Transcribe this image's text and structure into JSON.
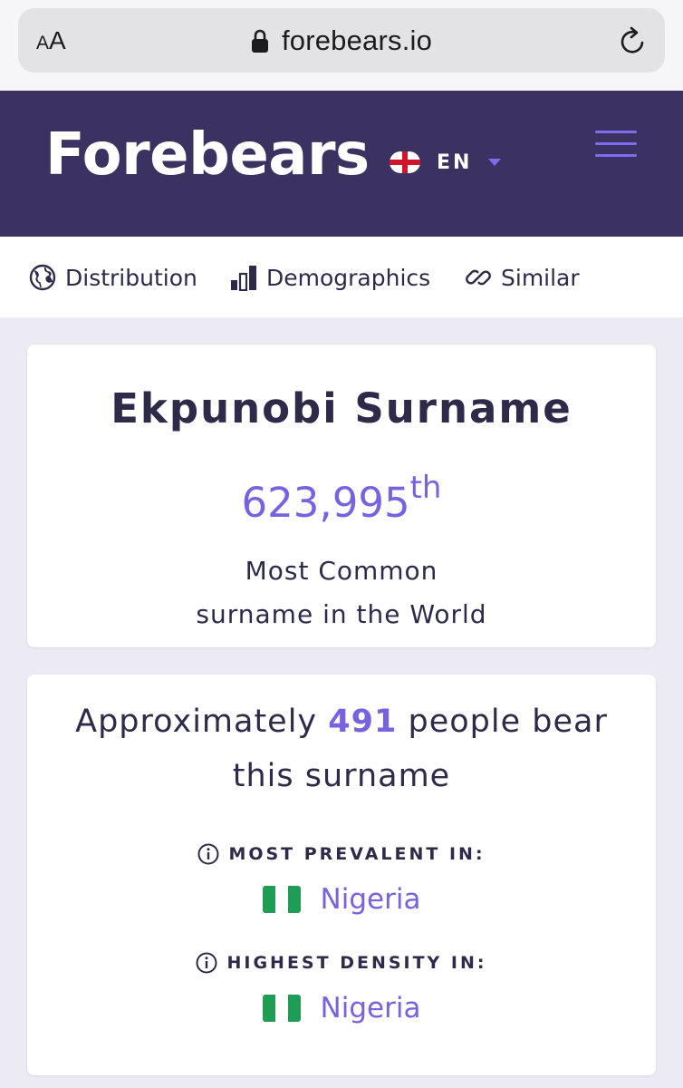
{
  "browser": {
    "text_size_small": "A",
    "text_size_big": "A",
    "url": "forebears.io"
  },
  "header": {
    "logo": "Forebears",
    "language": "EN"
  },
  "nav": {
    "items": [
      {
        "label": "Distribution",
        "icon": "globe-icon"
      },
      {
        "label": "Demographics",
        "icon": "bar-chart-icon"
      },
      {
        "label": "Similar",
        "icon": "link-icon"
      }
    ]
  },
  "summary": {
    "title": "Ekpunobi Surname",
    "rank": "623,995",
    "rank_suffix": "th",
    "rank_caption_line1": "Most Common",
    "rank_caption_line2": "surname in the World"
  },
  "population": {
    "prefix": "Approximately",
    "count": "491",
    "suffix": "people bear this surname",
    "most_prevalent_label": "MOST PREVALENT IN:",
    "most_prevalent_country": "Nigeria",
    "highest_density_label": "HIGHEST DENSITY IN:",
    "highest_density_country": "Nigeria"
  },
  "colors": {
    "header_bg": "#3c3262",
    "accent": "#7862e0",
    "text": "#2d2a4a",
    "page_bg": "#eceaf3"
  }
}
